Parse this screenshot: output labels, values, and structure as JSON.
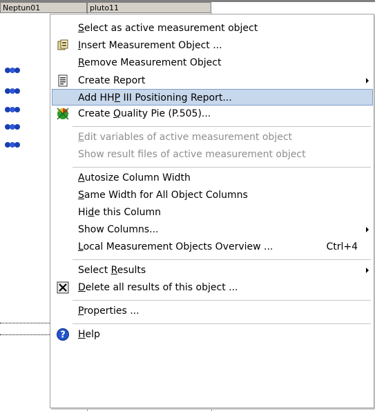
{
  "columns": [
    "Neptun01",
    "pluto11"
  ],
  "menu": {
    "items": [
      {
        "label": "Select as active measurement object",
        "accel": "S",
        "icon": "",
        "enabled": true
      },
      {
        "label": "Insert Measurement Object ...",
        "accel": "I",
        "icon": "insert-object-icon",
        "enabled": true
      },
      {
        "label": "Remove Measurement Object",
        "accel": "R",
        "icon": "",
        "enabled": true
      },
      {
        "label": "Create Report",
        "accel": "",
        "icon": "report-icon",
        "enabled": true,
        "submenu": true
      },
      {
        "label": "Add HHP III Positioning Report...",
        "accel": "P",
        "icon": "",
        "enabled": true,
        "highlighted": true
      },
      {
        "label": "Create Quality Pie (P.505)...",
        "accel": "Q",
        "icon": "quality-pie-icon",
        "enabled": true
      },
      {
        "label": "Edit variables of active measurement object",
        "accel": "E",
        "icon": "",
        "enabled": false
      },
      {
        "label": "Show result files of active measurement object",
        "accel": "",
        "icon": "",
        "enabled": false
      },
      {
        "label": "Autosize Column Width",
        "accel": "A",
        "icon": "",
        "enabled": true
      },
      {
        "label": "Same Width for All Object Columns",
        "accel": "S",
        "icon": "",
        "enabled": true
      },
      {
        "label": "Hide this Column",
        "accel": "d",
        "icon": "",
        "enabled": true
      },
      {
        "label": "Show Columns...",
        "accel": "",
        "icon": "",
        "enabled": true,
        "submenu": true
      },
      {
        "label": "Local Measurement Objects Overview ...",
        "accel": "L",
        "icon": "",
        "enabled": true,
        "shortcut": "Ctrl+4"
      },
      {
        "label": "Select Results",
        "accel": "R",
        "icon": "",
        "enabled": true,
        "submenu": true
      },
      {
        "label": "Delete all results of this object ...",
        "accel": "D",
        "icon": "delete-results-icon",
        "enabled": true
      },
      {
        "label": "Properties ...",
        "accel": "P",
        "icon": "",
        "enabled": true
      },
      {
        "label": "Help",
        "accel": "H",
        "icon": "help-icon",
        "enabled": true
      }
    ]
  },
  "colors": {
    "highlight_bg": "#c8d8ec",
    "highlight_border": "#7a9cc8",
    "disabled_text": "#8e8e8e",
    "row_icon": "#1a3fb0"
  }
}
